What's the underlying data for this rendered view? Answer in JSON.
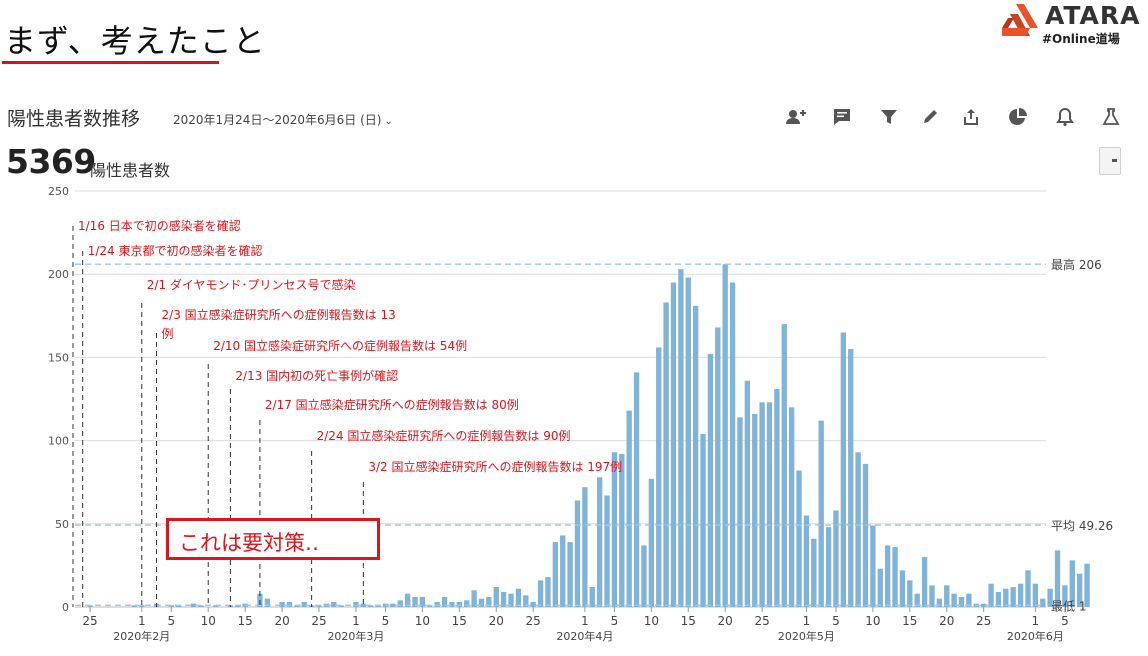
{
  "slide": {
    "title": "まず、考えたこと",
    "logo_text": "ATARA",
    "logo_sub": "#Online道場",
    "logo_color": "#e8532a"
  },
  "panel": {
    "title": "陽性患者数推移",
    "date_range": "2020年1月24日〜2020年6月6日 (日)",
    "total": "5369",
    "total_label": "陽性患者数",
    "toolbar": [
      "add-user-icon",
      "comment-icon",
      "filter-icon",
      "pencil-icon",
      "share-icon",
      "pie-chart-icon",
      "bell-icon",
      "flask-icon"
    ]
  },
  "callout": {
    "text": "これは要対策‥",
    "color": "#e0141b"
  },
  "chart_data": {
    "type": "bar",
    "x_start": "2020-01-24",
    "values": [
      0,
      1,
      0,
      0,
      0,
      0,
      0,
      1,
      1,
      0,
      2,
      0,
      1,
      1,
      0,
      2,
      1,
      0,
      1,
      0,
      1,
      1,
      2,
      0,
      8,
      5,
      0,
      3,
      3,
      1,
      3,
      1,
      1,
      2,
      3,
      1,
      0,
      3,
      2,
      1,
      1,
      2,
      2,
      4,
      8,
      6,
      6,
      1,
      3,
      6,
      3,
      3,
      4,
      10,
      5,
      6,
      12,
      9,
      8,
      11,
      7,
      3,
      16,
      18,
      39,
      43,
      39,
      64,
      72,
      12,
      78,
      67,
      93,
      92,
      118,
      141,
      37,
      77,
      156,
      183,
      195,
      203,
      198,
      181,
      104,
      152,
      168,
      206,
      195,
      114,
      136,
      116,
      123,
      123,
      131,
      170,
      120,
      82,
      55,
      41,
      112,
      48,
      58,
      165,
      155,
      93,
      86,
      49,
      23,
      37,
      36,
      22,
      16,
      8,
      30,
      13,
      5,
      13,
      8,
      6,
      8,
      2,
      2,
      14,
      9,
      11,
      12,
      14,
      22,
      14,
      5,
      11,
      34,
      13,
      28,
      20,
      26
    ],
    "ylim": [
      0,
      250
    ],
    "yticks": [
      0,
      50,
      100,
      150,
      200,
      250
    ],
    "bar_color": "#7fb3d8",
    "reference_lines": [
      {
        "label": "最高 206",
        "value": 206
      },
      {
        "label": "平均 49.26",
        "value": 49.26
      },
      {
        "label": "最低 1",
        "value": 1
      }
    ],
    "xticks": [
      {
        "date": "2020-01-25",
        "label": "25"
      },
      {
        "date": "2020-02-01",
        "label": "1"
      },
      {
        "date": "2020-02-05",
        "label": "5"
      },
      {
        "date": "2020-02-10",
        "label": "10"
      },
      {
        "date": "2020-02-15",
        "label": "15"
      },
      {
        "date": "2020-02-20",
        "label": "20"
      },
      {
        "date": "2020-02-25",
        "label": "25"
      },
      {
        "date": "2020-03-01",
        "label": "1"
      },
      {
        "date": "2020-03-05",
        "label": "5"
      },
      {
        "date": "2020-03-10",
        "label": "10"
      },
      {
        "date": "2020-03-15",
        "label": "15"
      },
      {
        "date": "2020-03-20",
        "label": "20"
      },
      {
        "date": "2020-03-25",
        "label": "25"
      },
      {
        "date": "2020-04-01",
        "label": "1"
      },
      {
        "date": "2020-04-05",
        "label": "5"
      },
      {
        "date": "2020-04-10",
        "label": "10"
      },
      {
        "date": "2020-04-15",
        "label": "15"
      },
      {
        "date": "2020-04-20",
        "label": "20"
      },
      {
        "date": "2020-04-25",
        "label": "25"
      },
      {
        "date": "2020-05-01",
        "label": "1"
      },
      {
        "date": "2020-05-05",
        "label": "5"
      },
      {
        "date": "2020-05-10",
        "label": "10"
      },
      {
        "date": "2020-05-15",
        "label": "15"
      },
      {
        "date": "2020-05-20",
        "label": "20"
      },
      {
        "date": "2020-05-25",
        "label": "25"
      },
      {
        "date": "2020-06-01",
        "label": "1"
      },
      {
        "date": "2020-06-05",
        "label": "5"
      }
    ],
    "month_labels": [
      {
        "date": "2020-02-01",
        "label": "2020年2月"
      },
      {
        "date": "2020-03-01",
        "label": "2020年3月"
      },
      {
        "date": "2020-04-01",
        "label": "2020年4月"
      },
      {
        "date": "2020-05-01",
        "label": "2020年5月"
      },
      {
        "date": "2020-06-01",
        "label": "2020年6月"
      }
    ],
    "annotations": [
      {
        "date": "2020-01-16",
        "text": "1/16 日本で初の感染者を確認"
      },
      {
        "date": "2020-01-24",
        "text": "1/24 東京都で初の感染者を確認"
      },
      {
        "date": "2020-02-01",
        "text": "2/1 ダイヤモンド･プリンセス号で感染"
      },
      {
        "date": "2020-02-03",
        "text": "2/3 国立感染症研究所への症例報告数は 13",
        "text2": "例"
      },
      {
        "date": "2020-02-10",
        "text": "2/10 国立感染症研究所への症例報告数は 54例"
      },
      {
        "date": "2020-02-13",
        "text": "2/13 国内初の死亡事例が確認"
      },
      {
        "date": "2020-02-17",
        "text": "2/17 国立感染症研究所への症例報告数は 80例"
      },
      {
        "date": "2020-02-24",
        "text": "2/24 国立感染症研究所への症例報告数は 90例"
      },
      {
        "date": "2020-03-02",
        "text": "3/2 国立感染症研究所への症例報告数は 197例"
      }
    ],
    "annotation_color": "#e0141b"
  }
}
